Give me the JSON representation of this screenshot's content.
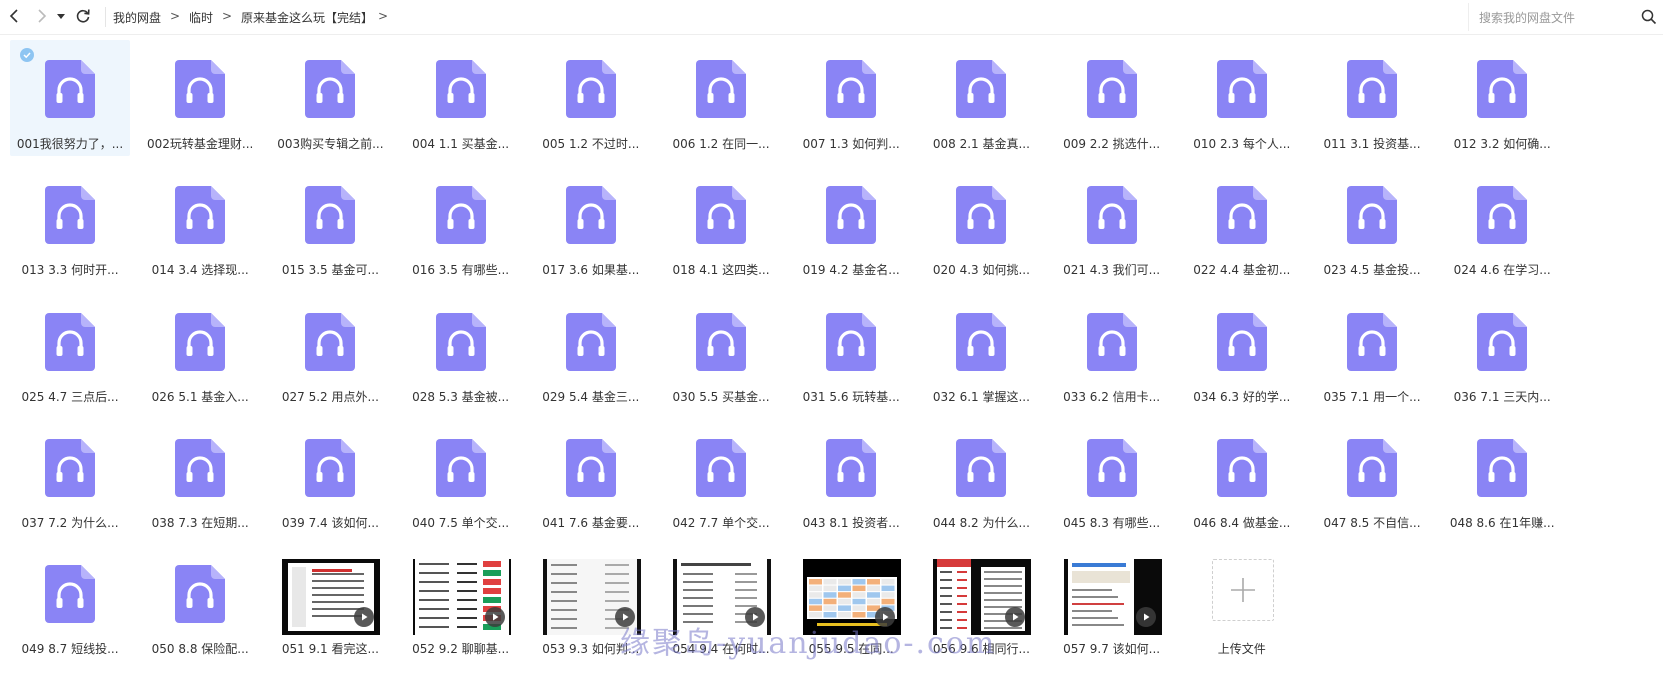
{
  "breadcrumb": [
    "我的网盘",
    "临时",
    "原来基金这么玩【完结】"
  ],
  "search": {
    "placeholder": "搜索我的网盘文件"
  },
  "colors": {
    "audio_icon": "#8a84f5",
    "audio_icon_fold": "#b7b3fb",
    "selected_bg": "#eef6fd"
  },
  "files": [
    {
      "label": "001我很努力了，...",
      "type": "audio",
      "selected": true
    },
    {
      "label": "002玩转基金理财...",
      "type": "audio"
    },
    {
      "label": "003购买专辑之前...",
      "type": "audio"
    },
    {
      "label": "004 1.1 买基金...",
      "type": "audio"
    },
    {
      "label": "005 1.2 不过时...",
      "type": "audio"
    },
    {
      "label": "006 1.2 在同一...",
      "type": "audio"
    },
    {
      "label": "007 1.3 如何判...",
      "type": "audio"
    },
    {
      "label": "008 2.1 基金真...",
      "type": "audio"
    },
    {
      "label": "009 2.2 挑选什...",
      "type": "audio"
    },
    {
      "label": "010 2.3 每个人...",
      "type": "audio"
    },
    {
      "label": "011 3.1 投资基...",
      "type": "audio"
    },
    {
      "label": "012 3.2 如何确...",
      "type": "audio"
    },
    {
      "label": "013 3.3 何时开...",
      "type": "audio"
    },
    {
      "label": "014 3.4 选择现...",
      "type": "audio"
    },
    {
      "label": "015 3.5 基金可...",
      "type": "audio"
    },
    {
      "label": "016 3.5 有哪些...",
      "type": "audio"
    },
    {
      "label": "017 3.6 如果基...",
      "type": "audio"
    },
    {
      "label": "018 4.1 这四类...",
      "type": "audio"
    },
    {
      "label": "019 4.2 基金名...",
      "type": "audio"
    },
    {
      "label": "020 4.3 如何挑...",
      "type": "audio"
    },
    {
      "label": "021 4.3 我们可...",
      "type": "audio"
    },
    {
      "label": "022 4.4 基金初...",
      "type": "audio"
    },
    {
      "label": "023 4.5 基金投...",
      "type": "audio"
    },
    {
      "label": "024 4.6 在学习...",
      "type": "audio"
    },
    {
      "label": "025 4.7 三点后...",
      "type": "audio"
    },
    {
      "label": "026 5.1 基金入...",
      "type": "audio"
    },
    {
      "label": "027 5.2 用点外...",
      "type": "audio"
    },
    {
      "label": "028 5.3 基金被...",
      "type": "audio"
    },
    {
      "label": "029 5.4 基金三...",
      "type": "audio"
    },
    {
      "label": "030 5.5 买基金...",
      "type": "audio"
    },
    {
      "label": "031 5.6 玩转基...",
      "type": "audio"
    },
    {
      "label": "032 6.1 掌握这...",
      "type": "audio"
    },
    {
      "label": "033 6.2 信用卡...",
      "type": "audio"
    },
    {
      "label": "034 6.3 好的学...",
      "type": "audio"
    },
    {
      "label": "035 7.1 用一个...",
      "type": "audio"
    },
    {
      "label": "036 7.1 三天内...",
      "type": "audio"
    },
    {
      "label": "037 7.2 为什么...",
      "type": "audio"
    },
    {
      "label": "038 7.3 在短期...",
      "type": "audio"
    },
    {
      "label": "039 7.4 该如何...",
      "type": "audio"
    },
    {
      "label": "040 7.5 单个交...",
      "type": "audio"
    },
    {
      "label": "041 7.6 基金要...",
      "type": "audio"
    },
    {
      "label": "042 7.7 单个交...",
      "type": "audio"
    },
    {
      "label": "043 8.1 投资者...",
      "type": "audio"
    },
    {
      "label": "044 8.2 为什么...",
      "type": "audio"
    },
    {
      "label": "045 8.3 有哪些...",
      "type": "audio"
    },
    {
      "label": "046 8.4 做基金...",
      "type": "audio"
    },
    {
      "label": "047 8.5 不自信...",
      "type": "audio"
    },
    {
      "label": "048 8.6 在1年赚...",
      "type": "audio"
    },
    {
      "label": "049 8.7 短线投...",
      "type": "audio"
    },
    {
      "label": "050 8.8 保险配...",
      "type": "audio"
    },
    {
      "label": "051 9.1 看完这...",
      "type": "video",
      "thumb": "dark-table"
    },
    {
      "label": "052 9.2 聊聊基...",
      "type": "video",
      "thumb": "phone-list"
    },
    {
      "label": "053 9.3 如何判...",
      "type": "video",
      "thumb": "white-list"
    },
    {
      "label": "054 9.4 在何时...",
      "type": "video",
      "thumb": "white-doc"
    },
    {
      "label": "055 9.5 在同...",
      "type": "video",
      "thumb": "spreadsheet"
    },
    {
      "label": "056 9.6 相同行...",
      "type": "video",
      "thumb": "red-table"
    },
    {
      "label": "057 9.7 该如何...",
      "type": "video",
      "thumb": "web-page"
    }
  ],
  "upload": {
    "label": "上传文件"
  },
  "watermark": "缘聚岛-yuanjudao-.com"
}
